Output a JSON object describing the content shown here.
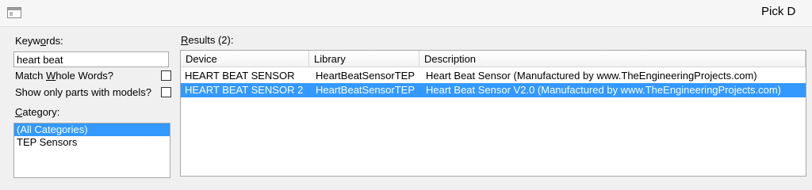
{
  "window": {
    "title": "Pick D"
  },
  "left_panel": {
    "keywords_label_prefix": "Keyw",
    "keywords_label_accel": "o",
    "keywords_label_suffix": "rds:",
    "keywords_value": "heart beat",
    "match_whole_prefix": "Match ",
    "match_whole_accel": "W",
    "match_whole_suffix": "hole Words?",
    "match_whole_checked": false,
    "show_models_label": "Show only parts with models?",
    "show_models_checked": false,
    "category_label_prefix": "",
    "category_label_accel": "C",
    "category_label_suffix": "ategory:",
    "categories": [
      "(All Categories)",
      "TEP Sensors"
    ],
    "selected_category": "(All Categories)"
  },
  "results": {
    "label_accel": "R",
    "label_suffix": "esults (2):",
    "columns": [
      "Device",
      "Library",
      "Description"
    ],
    "rows": [
      {
        "device": "HEART BEAT SENSOR",
        "library": "HeartBeatSensorTEP",
        "description": "Heart Beat Sensor (Manufactured by www.TheEngineeringProjects.com)",
        "selected": false
      },
      {
        "device": "HEART BEAT SENSOR 2",
        "library": "HeartBeatSensorTEP",
        "description": "Heart Beat Sensor V2.0 (Manufactured by www.TheEngineeringProjects.com)",
        "selected": true
      }
    ]
  },
  "colors": {
    "selection": "#3399ff",
    "window_bg": "#f0f0f0"
  }
}
